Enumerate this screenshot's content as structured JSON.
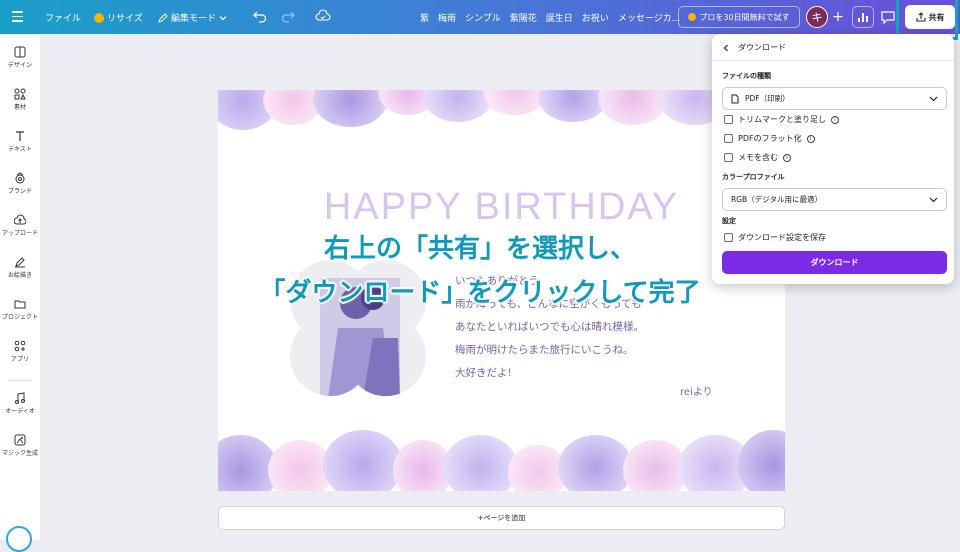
{
  "topbar": {
    "file_label": "ファイル",
    "resize_label": "リサイズ",
    "edit_mode_label": "編集モード",
    "keywords": [
      "紫",
      "梅雨",
      "シンプル",
      "紫陽花",
      "誕生日",
      "お祝い",
      "メッセージカ..."
    ],
    "pro_label": "プロを30日間無料で試す",
    "avatar_initial": "キ",
    "share_label": "共有"
  },
  "sidebar": {
    "items": [
      {
        "label": "デザイン",
        "icon": "design-icon"
      },
      {
        "label": "素材",
        "icon": "elements-icon"
      },
      {
        "label": "テキスト",
        "icon": "text-icon"
      },
      {
        "label": "ブランド",
        "icon": "brand-icon"
      },
      {
        "label": "アップロード",
        "icon": "upload-icon"
      },
      {
        "label": "お絵描き",
        "icon": "draw-icon"
      },
      {
        "label": "プロジェクト",
        "icon": "folder-icon"
      },
      {
        "label": "アプリ",
        "icon": "apps-icon"
      },
      {
        "label": "オーディオ",
        "icon": "audio-icon"
      },
      {
        "label": "マジック生成",
        "icon": "magic-icon"
      }
    ]
  },
  "canvas": {
    "title": "HAPPY BIRTHDAY",
    "letter_lines": [
      "いつもありがとう。",
      "雨が降っても、どんなに空がくもっても",
      "あなたといればいつでも心は晴れ模様。",
      "梅雨が明けたらまた旅行にいこうね。",
      "大好きだよ!"
    ],
    "signature": "reiより",
    "add_page_label": "+ページを追加"
  },
  "overlay": {
    "line1": "右上の「共有」を選択し、",
    "line2": "「ダウンロード」をクリックして完了"
  },
  "download_panel": {
    "title": "ダウンロード",
    "file_type_label": "ファイルの種類",
    "file_type_value": "PDF（印刷）",
    "options": [
      {
        "label": "トリムマークと塗り足し",
        "checked": false
      },
      {
        "label": "PDFのフラット化",
        "checked": false
      },
      {
        "label": "メモを含む",
        "checked": false
      }
    ],
    "color_profile_label": "カラープロファイル",
    "color_profile_value": "RGB（デジタル用に最適）",
    "settings_label": "設定",
    "save_setting_label": "ダウンロード設定を保存",
    "download_button": "ダウンロード"
  },
  "colors": {
    "accent": "#7d2ae8",
    "overlay_text": "#1298b8",
    "highlight_frame": "#14a5be",
    "title_text": "#d8c5ee",
    "letter_text": "#7a64a6"
  }
}
